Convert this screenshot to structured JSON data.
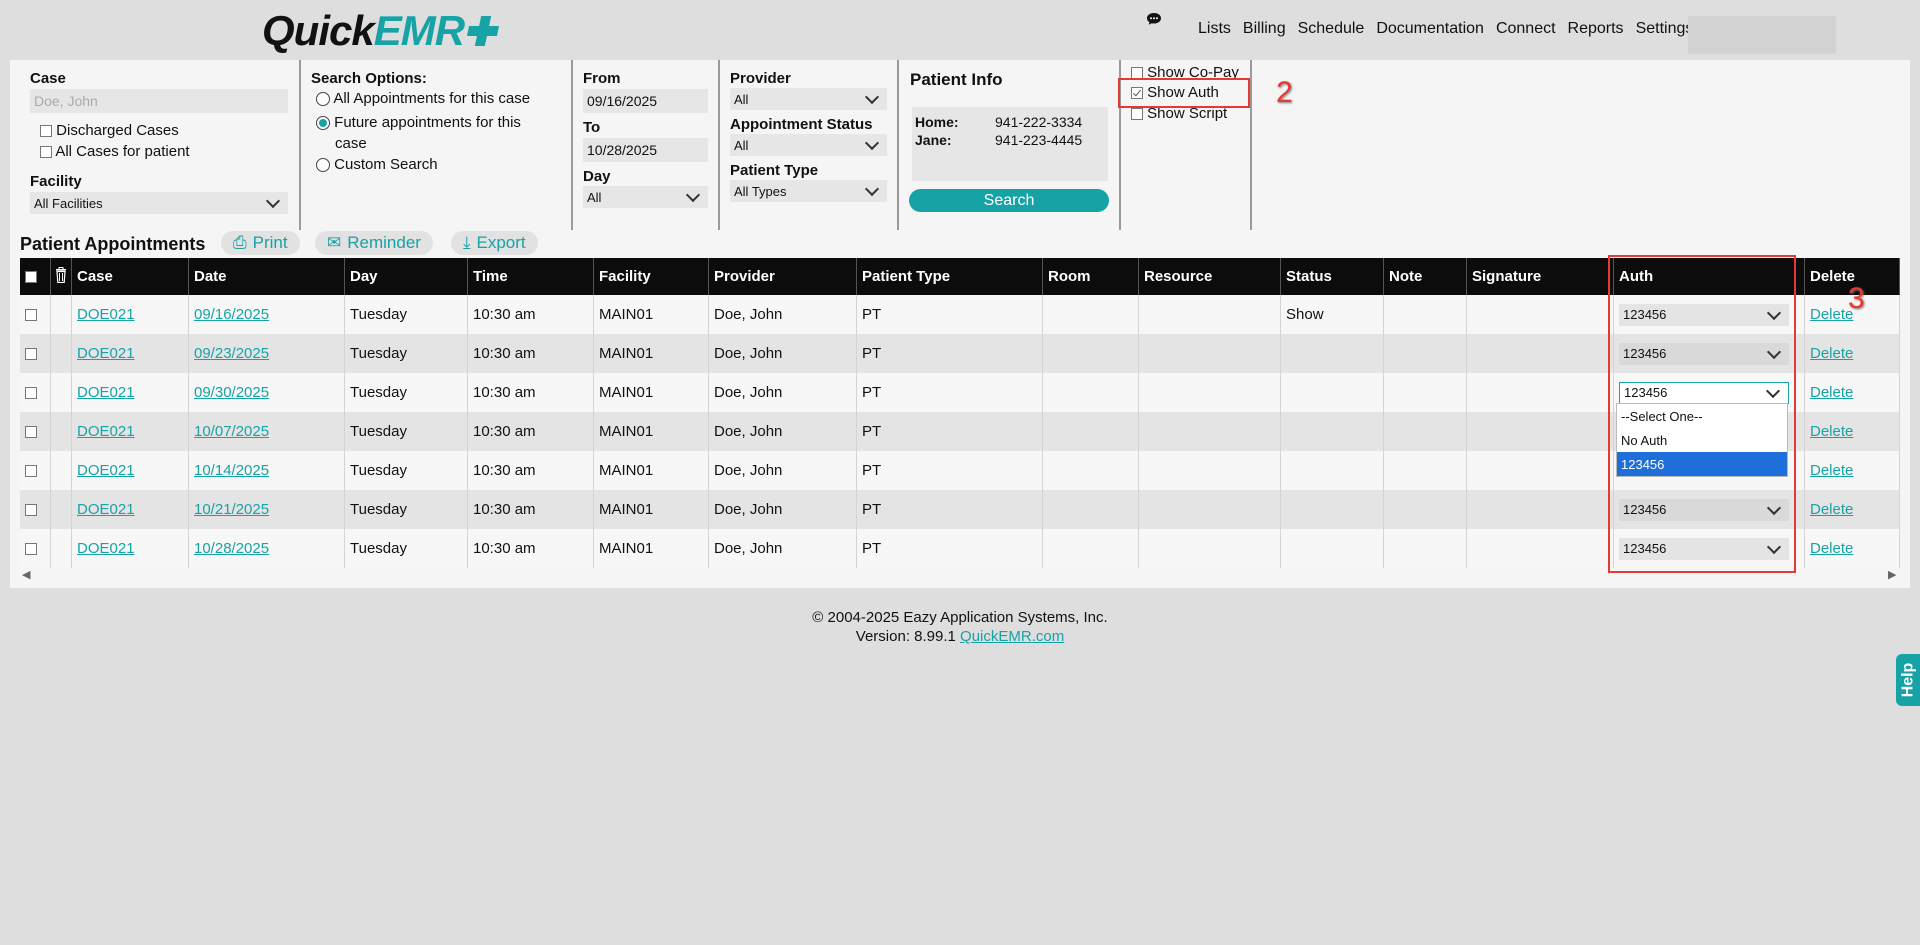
{
  "header": {
    "logo_text_a": "Quick",
    "logo_text_b": "EMR",
    "nav": [
      "Lists",
      "Billing",
      "Schedule",
      "Documentation",
      "Connect",
      "Reports",
      "Settings"
    ]
  },
  "filters": {
    "case_label": "Case",
    "case_placeholder": "Doe, John",
    "discharged_label": "Discharged Cases",
    "all_cases_label": "All Cases for patient",
    "facility_label": "Facility",
    "facility_value": "All Facilities",
    "search_options_label": "Search Options:",
    "opt_all": "All Appointments for this case",
    "opt_future_1": "Future appointments for this",
    "opt_future_2": "case",
    "opt_custom": "Custom Search",
    "from_label": "From",
    "from_value": "09/16/2025",
    "to_label": "To",
    "to_value": "10/28/2025",
    "day_label": "Day",
    "day_value": "All",
    "provider_label": "Provider",
    "provider_value": "All",
    "appt_status_label": "Appointment Status",
    "appt_status_value": "All",
    "patient_type_label": "Patient Type",
    "patient_type_value": "All Types"
  },
  "patient_info": {
    "title": "Patient Info",
    "home_label": "Home:",
    "home_value": "941-222-3334",
    "jane_label": "Jane:",
    "jane_value": "941-223-4445",
    "search_label": "Search"
  },
  "show_options": {
    "copay": "Show Co-Pay",
    "auth": "Show Auth",
    "script": "Show Script"
  },
  "annotations": {
    "a2": "2",
    "a3": "3"
  },
  "appointments": {
    "title": "Patient Appointments",
    "print": "Print",
    "reminder": "Reminder",
    "export": "Export",
    "columns": [
      "Case",
      "Date",
      "Day",
      "Time",
      "Facility",
      "Provider",
      "Patient Type",
      "Room",
      "Resource",
      "Status",
      "Note",
      "Signature",
      "Auth",
      "Delete"
    ],
    "rows": [
      {
        "case": "DOE021",
        "date": "09/16/2025",
        "day": "Tuesday",
        "time": "10:30 am",
        "facility": "MAIN01",
        "provider": "Doe, John",
        "ptype": "PT",
        "room": "",
        "resource": "",
        "status": "Show",
        "note": "",
        "signature": "",
        "auth": "123456",
        "delete": "Delete"
      },
      {
        "case": "DOE021",
        "date": "09/23/2025",
        "day": "Tuesday",
        "time": "10:30 am",
        "facility": "MAIN01",
        "provider": "Doe, John",
        "ptype": "PT",
        "room": "",
        "resource": "",
        "status": "",
        "note": "",
        "signature": "",
        "auth": "123456",
        "delete": "Delete"
      },
      {
        "case": "DOE021",
        "date": "09/30/2025",
        "day": "Tuesday",
        "time": "10:30 am",
        "facility": "MAIN01",
        "provider": "Doe, John",
        "ptype": "PT",
        "room": "",
        "resource": "",
        "status": "",
        "note": "",
        "signature": "",
        "auth": "123456",
        "delete": "Delete"
      },
      {
        "case": "DOE021",
        "date": "10/07/2025",
        "day": "Tuesday",
        "time": "10:30 am",
        "facility": "MAIN01",
        "provider": "Doe, John",
        "ptype": "PT",
        "room": "",
        "resource": "",
        "status": "",
        "note": "",
        "signature": "",
        "auth": "",
        "delete": "Delete"
      },
      {
        "case": "DOE021",
        "date": "10/14/2025",
        "day": "Tuesday",
        "time": "10:30 am",
        "facility": "MAIN01",
        "provider": "Doe, John",
        "ptype": "PT",
        "room": "",
        "resource": "",
        "status": "",
        "note": "",
        "signature": "",
        "auth": "",
        "delete": "Delete"
      },
      {
        "case": "DOE021",
        "date": "10/21/2025",
        "day": "Tuesday",
        "time": "10:30 am",
        "facility": "MAIN01",
        "provider": "Doe, John",
        "ptype": "PT",
        "room": "",
        "resource": "",
        "status": "",
        "note": "",
        "signature": "",
        "auth": "123456",
        "delete": "Delete"
      },
      {
        "case": "DOE021",
        "date": "10/28/2025",
        "day": "Tuesday",
        "time": "10:30 am",
        "facility": "MAIN01",
        "provider": "Doe, John",
        "ptype": "PT",
        "room": "",
        "resource": "",
        "status": "",
        "note": "",
        "signature": "",
        "auth": "123456",
        "delete": "Delete"
      }
    ],
    "auth_dropdown": [
      "--Select One--",
      "No Auth",
      "123456"
    ]
  },
  "footer": {
    "copyright": "© 2004-2025 Eazy Application Systems, Inc.",
    "version": "Version: 8.99.1",
    "link": "QuickEMR.com"
  },
  "help": "Help"
}
